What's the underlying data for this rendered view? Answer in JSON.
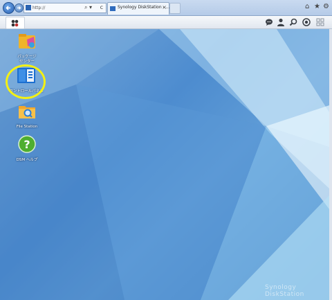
{
  "browser": {
    "address": "http://",
    "tab_title": "Synology DiskStation - ...",
    "tab_close": "×",
    "search_glyph": "⌕ ▾",
    "refresh_glyph": "c",
    "controls": {
      "home": "⌂",
      "favorites": "★",
      "tools": "⚙"
    }
  },
  "taskbar": {
    "icons": [
      "main-menu-icon",
      "notifications-icon",
      "user-icon",
      "search-icon",
      "widgets-icon",
      "windows-icon"
    ]
  },
  "desktop": {
    "apps": [
      {
        "label": "パッケージ\nセンター",
        "icon": "package-center-icon"
      },
      {
        "label": "コントロールパネル",
        "icon": "control-panel-icon",
        "highlighted": true
      },
      {
        "label": "File Station",
        "icon": "file-station-icon"
      },
      {
        "label": "DSM ヘルプ",
        "icon": "help-icon"
      }
    ],
    "highlight_color": "#f3f014",
    "watermark": "Synology DiskStation"
  }
}
